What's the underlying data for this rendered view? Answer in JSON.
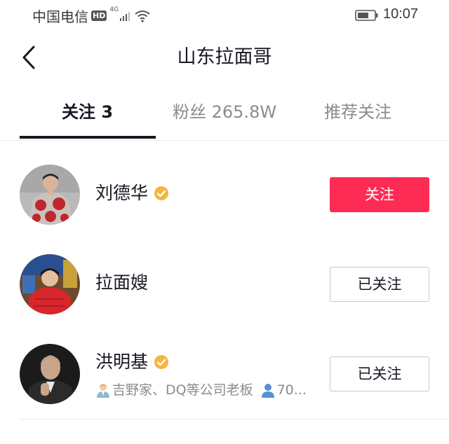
{
  "status_bar": {
    "carrier": "中国电信",
    "hd_badge": "HD",
    "network": "4G",
    "time": "10:07",
    "icons": [
      "hd-badge",
      "signal-icon",
      "wifi-icon",
      "battery-icon"
    ]
  },
  "header": {
    "title": "山东拉面哥",
    "back_icon": "chevron-left-icon"
  },
  "tabs": [
    {
      "label": "关注 3",
      "active": true
    },
    {
      "label": "粉丝 265.8W",
      "active": false
    },
    {
      "label": "推荐关注",
      "active": false
    }
  ],
  "users": [
    {
      "name": "刘德华",
      "verified": true,
      "button_label": "关注",
      "button_style": "primary",
      "description": "",
      "fans_snippet": ""
    },
    {
      "name": "拉面嫂",
      "verified": false,
      "button_label": "已关注",
      "button_style": "secondary",
      "description": "",
      "fans_snippet": ""
    },
    {
      "name": "洪明基",
      "verified": true,
      "button_label": "已关注",
      "button_style": "secondary",
      "description": "吉野家、DQ等公司老板",
      "fans_snippet": "70..."
    }
  ],
  "colors": {
    "accent": "#fe2c55",
    "verified": "#f5b53f",
    "text_primary": "#161823",
    "text_secondary": "#8a8b91"
  }
}
